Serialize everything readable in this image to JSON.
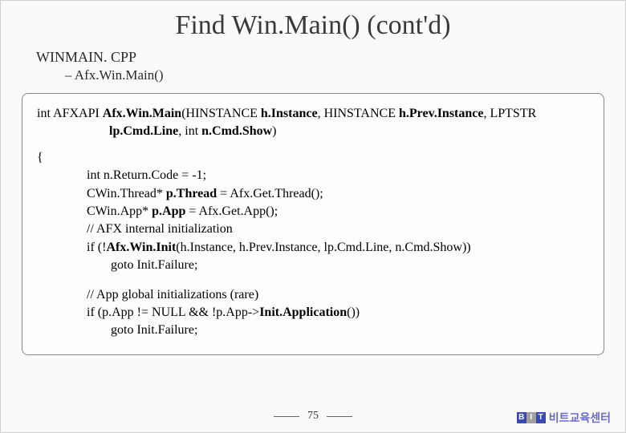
{
  "title": "Find Win.Main() (cont'd)",
  "subheader": "WINMAIN. CPP",
  "subitem": "– Afx.Win.Main()",
  "code": {
    "decl1_pre": "int AFXAPI ",
    "decl1_fn": "Afx.Win.Main",
    "decl1_mid1": "(HINSTANCE ",
    "decl1_p1": "h.Instance",
    "decl1_mid2": ", HINSTANCE ",
    "decl1_p2": "h.Prev.Instance",
    "decl1_mid3": ", LPTSTR",
    "decl2_p3": "lp.Cmd.Line",
    "decl2_mid": ", int ",
    "decl2_p4": "n.Cmd.Show",
    "decl2_end": ")",
    "brace": "{",
    "l1": "int n.Return.Code = -1;",
    "l2a": "CWin.Thread* ",
    "l2b": "p.Thread",
    "l2c": " = Afx.Get.Thread();",
    "l3a": "CWin.App* ",
    "l3b": "p.App",
    "l3c": " = Afx.Get.App();",
    "l4": "// AFX internal initialization",
    "l5a": "if (!",
    "l5b": "Afx.Win.Init",
    "l5c": "(h.Instance, h.Prev.Instance, lp.Cmd.Line, n.Cmd.Show))",
    "l6": "goto Init.Failure;",
    "l7": "// App global initializations (rare)",
    "l8a": "if (p.App != NULL && !p.App->",
    "l8b": "Init.Application",
    "l8c": "())",
    "l9": "goto Init.Failure;"
  },
  "pageNumber": "75",
  "logo": {
    "b": "B",
    "i": "I",
    "t": "T"
  },
  "brand": "비트교육센터"
}
